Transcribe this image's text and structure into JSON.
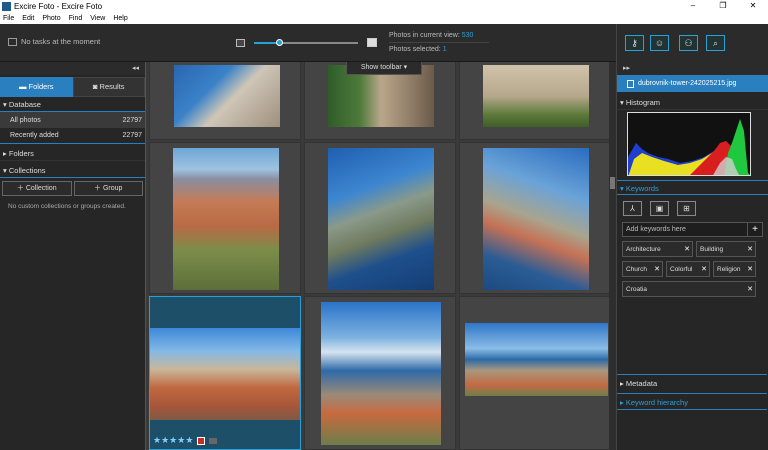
{
  "window": {
    "title": "Excire Foto - Excire Foto",
    "minimize": "–",
    "maximize": "❐",
    "close": "✕"
  },
  "menu": [
    "File",
    "Edit",
    "Photo",
    "Find",
    "View",
    "Help"
  ],
  "toolbar": {
    "tasks_text": "No tasks at the moment",
    "zoom_level": 0.25,
    "photos_in_view_label": "Photos in current view:",
    "photos_in_view_value": "530",
    "photos_selected_label": "Photos selected:",
    "photos_selected_value": "1",
    "right_tools": [
      "key-icon",
      "face-icon",
      "people-icon",
      "search-icon"
    ]
  },
  "left_panel": {
    "collapse": "◂◂",
    "tabs": [
      {
        "label": "Folders",
        "icon": "folder-icon"
      },
      {
        "label": "Results",
        "icon": "results-icon"
      }
    ],
    "database": {
      "title": "Database",
      "rows": [
        {
          "label": "All photos",
          "count": "22797"
        },
        {
          "label": "Recently added",
          "count": "22797"
        }
      ]
    },
    "folders_title": "Folders",
    "collections_title": "Collections",
    "collection_btn": "Collection",
    "group_btn": "Group",
    "note": "No custom collections or groups created."
  },
  "grid": {
    "show_toolbar": "Show toolbar",
    "rating": 5,
    "accent": "#2aa0d8"
  },
  "right_panel": {
    "collapse": "▸▸",
    "filename": "dubrovnik-tower-242025215.jpg",
    "histogram_title": "Histogram",
    "keywords_title": "Keywords",
    "keyword_placeholder": "Add keywords here",
    "keywords": [
      "Architecture",
      "Building",
      "Church",
      "Colorful",
      "Religion",
      "Croatia"
    ],
    "metadata_title": "Metadata",
    "hierarchy_title": "Keyword hierarchy"
  }
}
